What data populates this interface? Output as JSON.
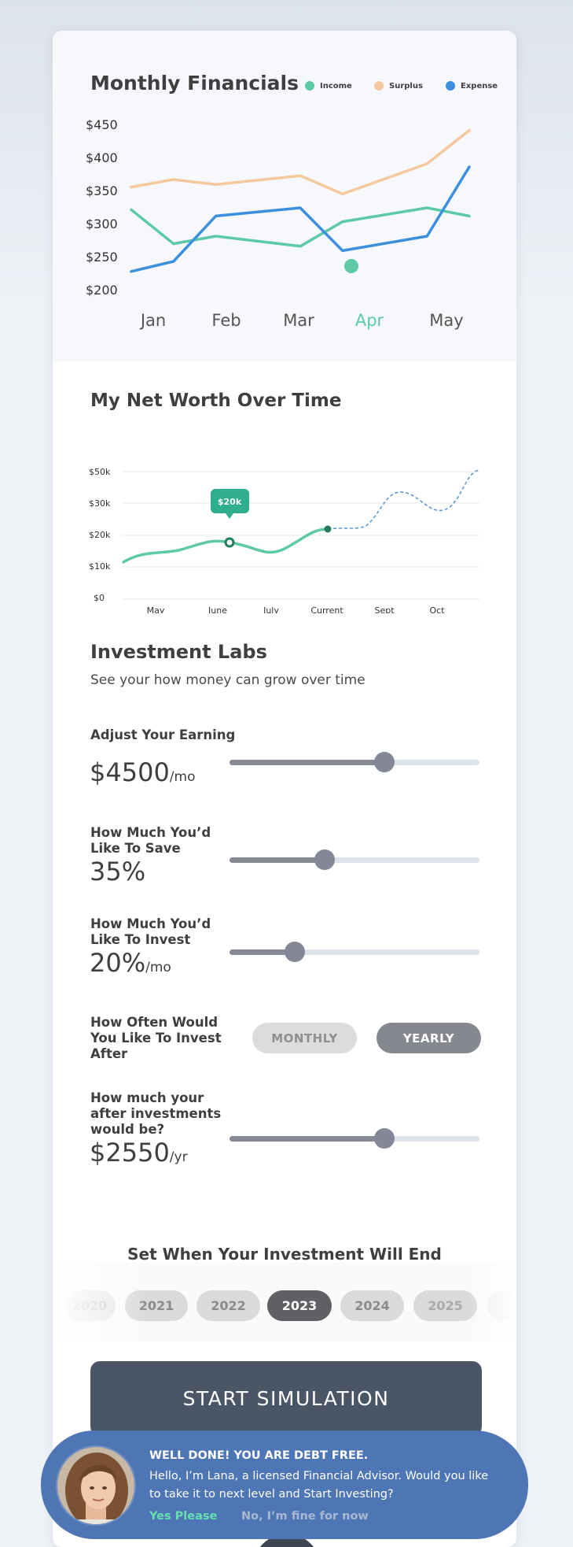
{
  "financials": {
    "title": "Monthly Financials",
    "legend": [
      {
        "label": "Income",
        "color": "#5ec9a7"
      },
      {
        "label": "Surplus",
        "color": "#f5c89d"
      },
      {
        "label": "Expense",
        "color": "#3b8fdd"
      }
    ],
    "y_ticks": [
      "$450",
      "$400",
      "$350",
      "$300",
      "$250",
      "$200"
    ],
    "months": [
      "Jan",
      "Feb",
      "Mar",
      "Apr",
      "May"
    ],
    "selected_month": "Apr",
    "selected_color": "#5ec9a7"
  },
  "networth": {
    "title": "My Net Worth Over Time",
    "y_ticks": [
      "$50k",
      "$30k",
      "$20k",
      "$10k",
      "$0"
    ],
    "x_ticks": [
      "May",
      "June",
      "July",
      "Current",
      "Sept",
      "Oct"
    ],
    "tooltip": "$20k",
    "line_color": "#5ec9a7",
    "projection_color": "#5b9bd5",
    "tooltip_color": "#2fae8d"
  },
  "labs": {
    "title": "Investment Labs",
    "subtitle": "See your how money can grow over time",
    "earning": {
      "label": "Adjust Your Earning",
      "value": "$4500",
      "unit": "/mo",
      "level": 0.62
    },
    "save": {
      "label": "How Much You’d Like To Save",
      "value": "35%",
      "level": 0.38
    },
    "invest": {
      "label": "How Much You’d Like To Invest",
      "value": "20%",
      "unit": "/mo",
      "level": 0.26
    },
    "frequency": {
      "label": "How Often Would You Like To Invest After",
      "options": [
        "MONTHLY",
        "YEARLY"
      ],
      "selected": "YEARLY"
    },
    "after": {
      "label": "How much your after investments would be?",
      "value": "$2550",
      "unit": "/yr",
      "level": 0.62
    }
  },
  "end": {
    "title": "Set When Your Investment Will End",
    "years": [
      "2020",
      "2021",
      "2022",
      "2023",
      "2024",
      "2025"
    ],
    "selected": "2023"
  },
  "cta": {
    "label": "START SIMULATION"
  },
  "advisor": {
    "headline": "WELL DONE! YOU ARE DEBT FREE.",
    "message": "Hello, I’m Lana, a licensed Financial Advisor. Would you like to take it to next level and Start Investing?",
    "yes": "Yes Please",
    "no": "No, I’m fine for now"
  },
  "chart_data": [
    {
      "type": "line",
      "title": "Monthly Financials",
      "categories": [
        "Jan",
        "Feb",
        "Mar",
        "Apr",
        "May"
      ],
      "x": [
        "Jan",
        "Jan-Feb",
        "Feb",
        "Feb-Mar",
        "Mar",
        "Mar-Apr",
        "Apr",
        "Apr-May",
        "May"
      ],
      "series": [
        {
          "name": "Income",
          "values": [
            322,
            268,
            280,
            264,
            303,
            325,
            312
          ]
        },
        {
          "name": "Surplus",
          "values": [
            358,
            370,
            362,
            376,
            347,
            395,
            448
          ]
        },
        {
          "name": "Expense",
          "values": [
            224,
            240,
            312,
            325,
            257,
            280,
            390
          ]
        }
      ],
      "ylim": [
        200,
        450
      ],
      "grid": false,
      "legend": "top-right"
    },
    {
      "type": "line",
      "title": "My Net Worth Over Time",
      "categories": [
        "May",
        "June",
        "July",
        "Current",
        "Sept",
        "Oct"
      ],
      "series": [
        {
          "name": "Net worth",
          "values": [
            12000,
            14500,
            18000,
            15000,
            22000
          ]
        },
        {
          "name": "Projection",
          "values": [
            22000,
            24000,
            34000,
            28000,
            40000
          ]
        }
      ],
      "annotation": "$20k",
      "y_ticks": [
        "$0",
        "$10k",
        "$20k",
        "$30k",
        "$50k"
      ],
      "grid": true
    }
  ]
}
